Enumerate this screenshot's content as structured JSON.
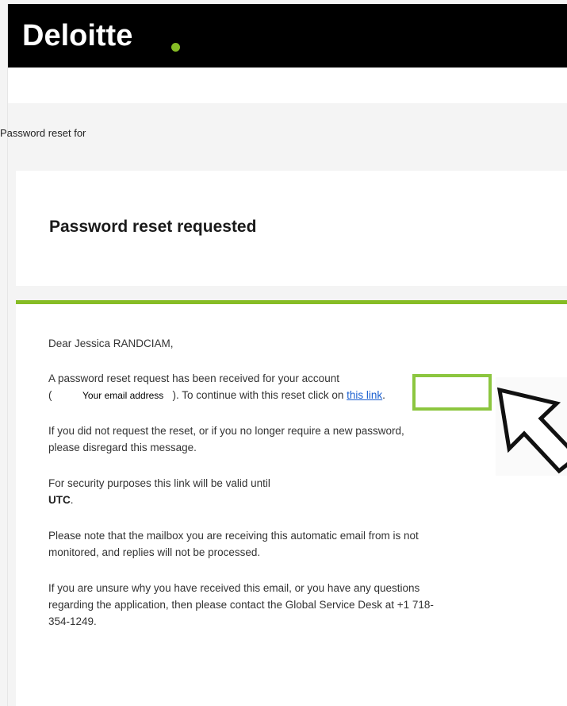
{
  "brand": {
    "name": "Deloitte",
    "accent": "#86bc25"
  },
  "preheader": "Password reset for",
  "heading": "Password reset requested",
  "body": {
    "greeting": "Dear Jessica RANDCIAM,",
    "request_line1": "A password reset request has been received for your account",
    "request_line2_open": "(",
    "email_label": "Your email address",
    "request_line2_rest": "). To continue with this reset click on",
    "link_text": "this link",
    "request_line2_end": ".",
    "disregard_line1": "If you did not request the reset, or if you no longer require a new password,",
    "disregard_line2": "please disregard this message.",
    "validity_line1": "For security purposes this link will be valid until",
    "validity_utc": "UTC",
    "validity_end": ".",
    "mailbox_line1": "Please note that the mailbox you are receiving this automatic email from is not",
    "mailbox_line2": "monitored, and replies will not be processed.",
    "contact_line1": "If you are unsure why you have received this email, or you have any questions",
    "contact_line2": "regarding the application, then please contact the Global Service Desk at +1 718-",
    "contact_line3": "354-1249."
  },
  "annotation": {
    "highlight_color": "#8cc63f",
    "pointer": "cursor-arrow-icon"
  }
}
